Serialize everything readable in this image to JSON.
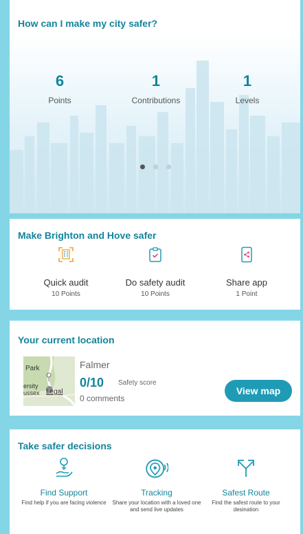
{
  "hero": {
    "title": "How can I make my city safer?",
    "stats": [
      {
        "value": "6",
        "label": "Points"
      },
      {
        "value": "1",
        "label": "Contributions"
      },
      {
        "value": "1",
        "label": "Levels"
      }
    ],
    "carousel_pages": 3,
    "carousel_active": 1
  },
  "make_safer": {
    "title": "Make Brighton and Hove safer",
    "actions": [
      {
        "icon": "building-scan-icon",
        "name": "Quick audit",
        "points": "10 Points"
      },
      {
        "icon": "clipboard-check-icon",
        "name": "Do safety audit",
        "points": "10 Points"
      },
      {
        "icon": "phone-share-icon",
        "name": "Share app",
        "points": "1 Point"
      }
    ]
  },
  "location": {
    "title": "Your current location",
    "name": "Falmer",
    "score": "0/10",
    "score_label": "Safety score",
    "comments": "0 comments",
    "view_map": "View map",
    "map_labels": {
      "park": "Park",
      "ersity": "ersity",
      "ussex": "ussex",
      "legal": "Legal"
    }
  },
  "decisions": {
    "title": "Take safer decisions",
    "items": [
      {
        "icon": "female-hand-icon",
        "name": "Find Support",
        "desc": "Find help if you are facing violence"
      },
      {
        "icon": "location-signal-icon",
        "name": "Tracking",
        "desc": "Share your location with a loved one and send live updates"
      },
      {
        "icon": "split-arrows-icon",
        "name": "Safest Route",
        "desc": "Find the safest route to your desination"
      }
    ]
  },
  "colors": {
    "accent": "#13849c",
    "button": "#1f9bb6",
    "background": "#84d6e6",
    "icon_orange": "#f0a030",
    "icon_pink": "#e0447a"
  }
}
